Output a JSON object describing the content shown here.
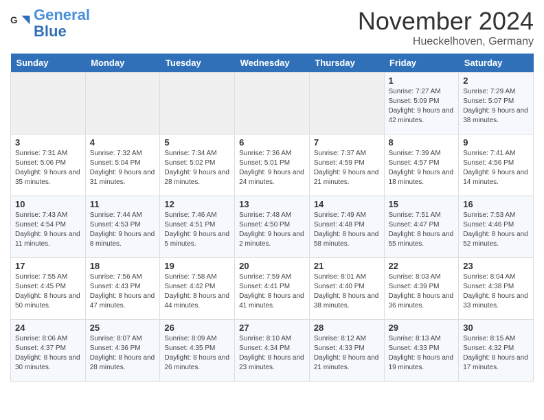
{
  "header": {
    "logo_line1": "General",
    "logo_line2": "Blue",
    "month": "November 2024",
    "location": "Hueckelhoven, Germany"
  },
  "days_of_week": [
    "Sunday",
    "Monday",
    "Tuesday",
    "Wednesday",
    "Thursday",
    "Friday",
    "Saturday"
  ],
  "weeks": [
    [
      {
        "day": "",
        "empty": true
      },
      {
        "day": "",
        "empty": true
      },
      {
        "day": "",
        "empty": true
      },
      {
        "day": "",
        "empty": true
      },
      {
        "day": "",
        "empty": true
      },
      {
        "day": "1",
        "sunrise": "Sunrise: 7:27 AM",
        "sunset": "Sunset: 5:09 PM",
        "daylight": "Daylight: 9 hours and 42 minutes."
      },
      {
        "day": "2",
        "sunrise": "Sunrise: 7:29 AM",
        "sunset": "Sunset: 5:07 PM",
        "daylight": "Daylight: 9 hours and 38 minutes."
      }
    ],
    [
      {
        "day": "3",
        "sunrise": "Sunrise: 7:31 AM",
        "sunset": "Sunset: 5:06 PM",
        "daylight": "Daylight: 9 hours and 35 minutes."
      },
      {
        "day": "4",
        "sunrise": "Sunrise: 7:32 AM",
        "sunset": "Sunset: 5:04 PM",
        "daylight": "Daylight: 9 hours and 31 minutes."
      },
      {
        "day": "5",
        "sunrise": "Sunrise: 7:34 AM",
        "sunset": "Sunset: 5:02 PM",
        "daylight": "Daylight: 9 hours and 28 minutes."
      },
      {
        "day": "6",
        "sunrise": "Sunrise: 7:36 AM",
        "sunset": "Sunset: 5:01 PM",
        "daylight": "Daylight: 9 hours and 24 minutes."
      },
      {
        "day": "7",
        "sunrise": "Sunrise: 7:37 AM",
        "sunset": "Sunset: 4:59 PM",
        "daylight": "Daylight: 9 hours and 21 minutes."
      },
      {
        "day": "8",
        "sunrise": "Sunrise: 7:39 AM",
        "sunset": "Sunset: 4:57 PM",
        "daylight": "Daylight: 9 hours and 18 minutes."
      },
      {
        "day": "9",
        "sunrise": "Sunrise: 7:41 AM",
        "sunset": "Sunset: 4:56 PM",
        "daylight": "Daylight: 9 hours and 14 minutes."
      }
    ],
    [
      {
        "day": "10",
        "sunrise": "Sunrise: 7:43 AM",
        "sunset": "Sunset: 4:54 PM",
        "daylight": "Daylight: 9 hours and 11 minutes."
      },
      {
        "day": "11",
        "sunrise": "Sunrise: 7:44 AM",
        "sunset": "Sunset: 4:53 PM",
        "daylight": "Daylight: 9 hours and 8 minutes."
      },
      {
        "day": "12",
        "sunrise": "Sunrise: 7:46 AM",
        "sunset": "Sunset: 4:51 PM",
        "daylight": "Daylight: 9 hours and 5 minutes."
      },
      {
        "day": "13",
        "sunrise": "Sunrise: 7:48 AM",
        "sunset": "Sunset: 4:50 PM",
        "daylight": "Daylight: 9 hours and 2 minutes."
      },
      {
        "day": "14",
        "sunrise": "Sunrise: 7:49 AM",
        "sunset": "Sunset: 4:48 PM",
        "daylight": "Daylight: 8 hours and 58 minutes."
      },
      {
        "day": "15",
        "sunrise": "Sunrise: 7:51 AM",
        "sunset": "Sunset: 4:47 PM",
        "daylight": "Daylight: 8 hours and 55 minutes."
      },
      {
        "day": "16",
        "sunrise": "Sunrise: 7:53 AM",
        "sunset": "Sunset: 4:46 PM",
        "daylight": "Daylight: 8 hours and 52 minutes."
      }
    ],
    [
      {
        "day": "17",
        "sunrise": "Sunrise: 7:55 AM",
        "sunset": "Sunset: 4:45 PM",
        "daylight": "Daylight: 8 hours and 50 minutes."
      },
      {
        "day": "18",
        "sunrise": "Sunrise: 7:56 AM",
        "sunset": "Sunset: 4:43 PM",
        "daylight": "Daylight: 8 hours and 47 minutes."
      },
      {
        "day": "19",
        "sunrise": "Sunrise: 7:58 AM",
        "sunset": "Sunset: 4:42 PM",
        "daylight": "Daylight: 8 hours and 44 minutes."
      },
      {
        "day": "20",
        "sunrise": "Sunrise: 7:59 AM",
        "sunset": "Sunset: 4:41 PM",
        "daylight": "Daylight: 8 hours and 41 minutes."
      },
      {
        "day": "21",
        "sunrise": "Sunrise: 8:01 AM",
        "sunset": "Sunset: 4:40 PM",
        "daylight": "Daylight: 8 hours and 38 minutes."
      },
      {
        "day": "22",
        "sunrise": "Sunrise: 8:03 AM",
        "sunset": "Sunset: 4:39 PM",
        "daylight": "Daylight: 8 hours and 36 minutes."
      },
      {
        "day": "23",
        "sunrise": "Sunrise: 8:04 AM",
        "sunset": "Sunset: 4:38 PM",
        "daylight": "Daylight: 8 hours and 33 minutes."
      }
    ],
    [
      {
        "day": "24",
        "sunrise": "Sunrise: 8:06 AM",
        "sunset": "Sunset: 4:37 PM",
        "daylight": "Daylight: 8 hours and 30 minutes."
      },
      {
        "day": "25",
        "sunrise": "Sunrise: 8:07 AM",
        "sunset": "Sunset: 4:36 PM",
        "daylight": "Daylight: 8 hours and 28 minutes."
      },
      {
        "day": "26",
        "sunrise": "Sunrise: 8:09 AM",
        "sunset": "Sunset: 4:35 PM",
        "daylight": "Daylight: 8 hours and 26 minutes."
      },
      {
        "day": "27",
        "sunrise": "Sunrise: 8:10 AM",
        "sunset": "Sunset: 4:34 PM",
        "daylight": "Daylight: 8 hours and 23 minutes."
      },
      {
        "day": "28",
        "sunrise": "Sunrise: 8:12 AM",
        "sunset": "Sunset: 4:33 PM",
        "daylight": "Daylight: 8 hours and 21 minutes."
      },
      {
        "day": "29",
        "sunrise": "Sunrise: 8:13 AM",
        "sunset": "Sunset: 4:33 PM",
        "daylight": "Daylight: 8 hours and 19 minutes."
      },
      {
        "day": "30",
        "sunrise": "Sunrise: 8:15 AM",
        "sunset": "Sunset: 4:32 PM",
        "daylight": "Daylight: 8 hours and 17 minutes."
      }
    ]
  ]
}
